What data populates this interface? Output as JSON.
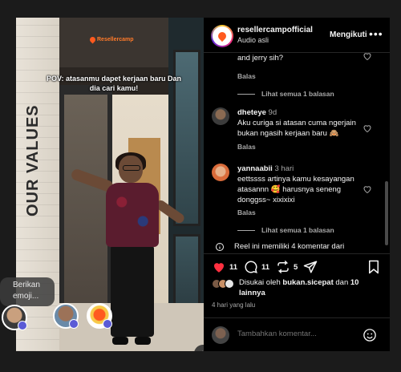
{
  "video": {
    "logo_text": "Resellercamp",
    "caption": "POV: atasanmu dapet kerjaan baru Dan dia cari kamu!",
    "wall_text": "OUR VALUES"
  },
  "reactions": {
    "emoji_prompt": "Berikan emoji..."
  },
  "post": {
    "account_name": "resellercampofficial",
    "audio_label": "Audio asli",
    "follow_label": "Mengikuti",
    "more_label": "•••"
  },
  "comments": [
    {
      "id": "c0",
      "text_tail": "and jerry sih?",
      "reply_label": "Balas",
      "view_replies": "Lihat semua 1 balasan"
    },
    {
      "id": "c1",
      "user": "dheteye",
      "time": "9d",
      "text": "Aku curiga si atasan cuma ngerjain bukan ngasih kerjaan baru 🙈",
      "reply_label": "Balas"
    },
    {
      "id": "c2",
      "user": "yannaabii",
      "time": "3 hari",
      "text": "eettssss artinya kamu kesayangan atasannn 🥰 harusnya seneng donggss~ xixixixi",
      "reply_label": "Balas",
      "view_replies": "Lihat semua 1 balasan"
    }
  ],
  "reel_note": "Reel ini memiliki 4 komentar dari",
  "actions": {
    "likes_count": "11",
    "comments_count": "11",
    "reposts_count": "5"
  },
  "likes": {
    "prefix": "Disukai oleh",
    "user": "bukan.sicepat",
    "connector": "dan",
    "others": "10 lainnya"
  },
  "date_label": "4 hari yang lalu",
  "add_comment": {
    "placeholder": "Tambahkan komentar..."
  },
  "colors": {
    "like_red": "#ff3040",
    "panel_bg": "#000000",
    "muted_text": "#a8a8a8",
    "brand_orange": "#ff5a1f"
  }
}
